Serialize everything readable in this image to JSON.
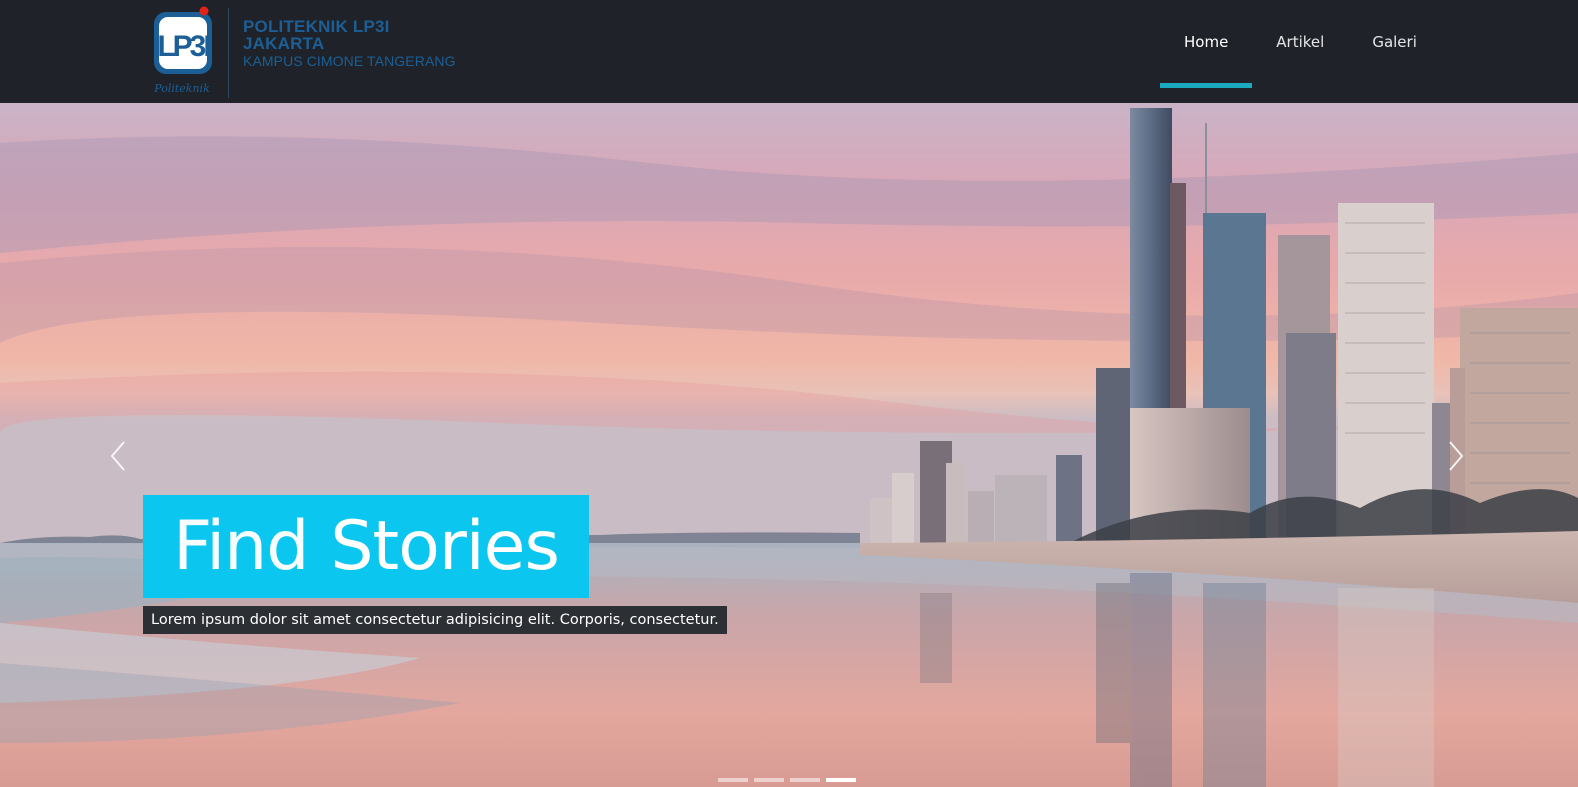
{
  "brand": {
    "logo_text": "LP3I",
    "logo_script": "Politeknik",
    "line1": "POLITEKNIK LP3I",
    "line2": "JAKARTA",
    "line3": "KAMPUS CIMONE TANGERANG"
  },
  "nav": {
    "items": [
      {
        "label": "Home",
        "active": true
      },
      {
        "label": "Artikel",
        "active": false
      },
      {
        "label": "Galeri",
        "active": false
      }
    ]
  },
  "hero": {
    "title_light": "Find",
    "title_bold": "Stories",
    "subtitle": "Lorem ipsum dolor sit amet consectetur adipisicing elit. Corporis, consectetur.",
    "prev_icon": "chevron-left-icon",
    "next_icon": "chevron-right-icon",
    "slide_count": 4,
    "active_slide": 4
  },
  "colors": {
    "navbar": "#1f2329",
    "accent": "#1aa9c1",
    "caption_bg": "#0bc7ef",
    "brand_text": "#1b5f96"
  }
}
